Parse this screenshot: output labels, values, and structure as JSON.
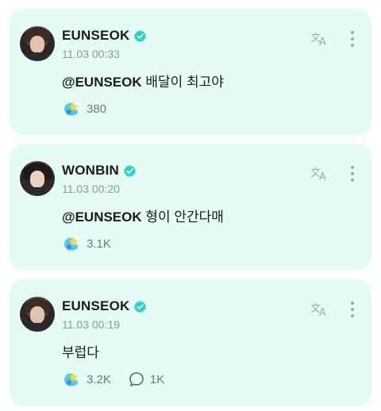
{
  "colors": {
    "card_bg": "#e5fbf6",
    "verified": "#2fd1c4",
    "muted": "#8d9897"
  },
  "posts": [
    {
      "author": "EUNSEOK",
      "timestamp": "11.03 00:33",
      "mention": "@EUNSEOK",
      "text": " 배달이 최고야",
      "likes": "380",
      "comments": null
    },
    {
      "author": "WONBIN",
      "timestamp": "11.03 00:20",
      "mention": "@EUNSEOK",
      "text": " 형이 안간다매",
      "likes": "3.1K",
      "comments": null
    },
    {
      "author": "EUNSEOK",
      "timestamp": "11.03 00:19",
      "mention": "",
      "text": "부럽다",
      "likes": "3.2K",
      "comments": "1K"
    }
  ],
  "icons": {
    "verified": "verified-badge-icon",
    "translate": "translate-icon",
    "more": "more-vertical-icon",
    "like": "fan-reaction-icon",
    "comment": "comment-bubble-icon"
  }
}
